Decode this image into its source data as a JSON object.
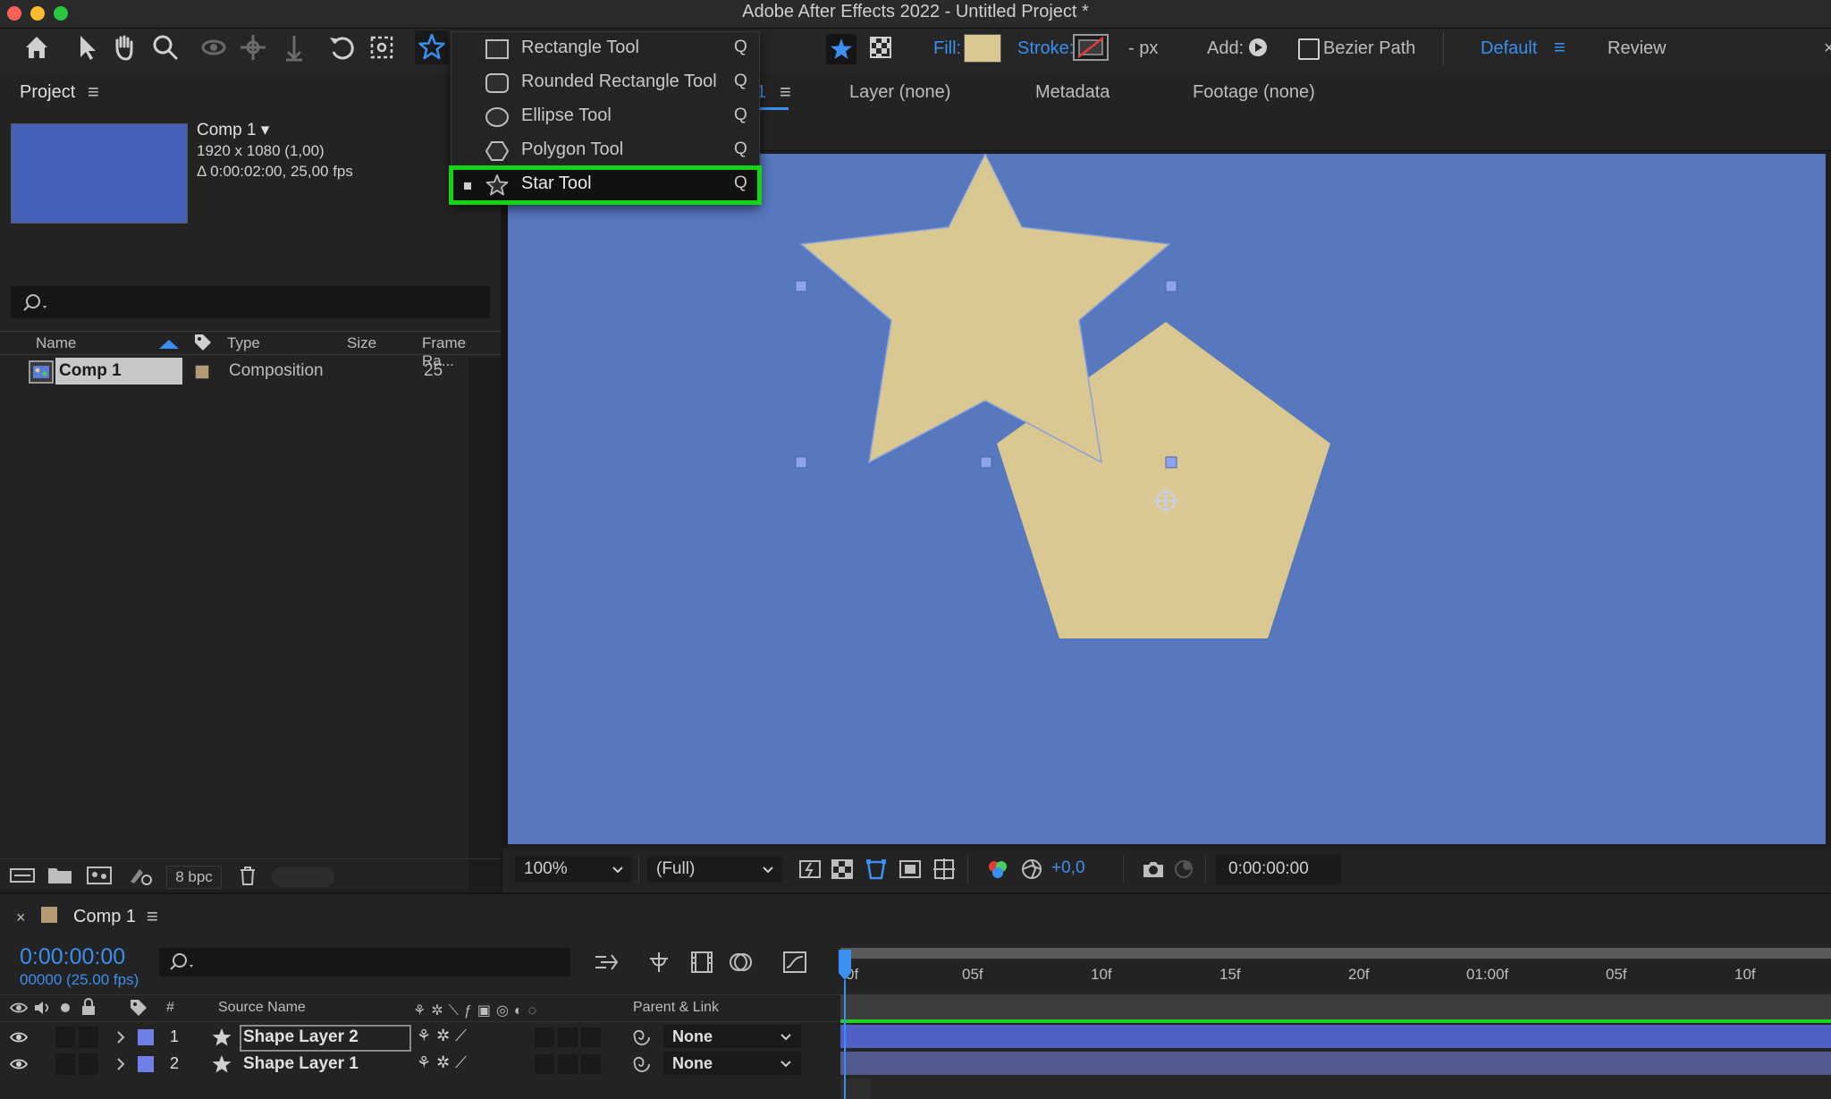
{
  "window": {
    "title": "Adobe After Effects 2022 - Untitled Project *"
  },
  "toolbar": {
    "fill_label": "Fill:",
    "stroke_label": "Stroke:",
    "stroke_px": "- px",
    "add_label": "Add:",
    "bezier_label": "Bezier Path",
    "workspace_default": "Default",
    "workspace_review": "Review",
    "fill_color": "#d9c891"
  },
  "tool_menu": {
    "items": [
      {
        "label": "Rectangle Tool",
        "key": "Q"
      },
      {
        "label": "Rounded Rectangle Tool",
        "key": "Q"
      },
      {
        "label": "Ellipse Tool",
        "key": "Q"
      },
      {
        "label": "Polygon Tool",
        "key": "Q"
      },
      {
        "label": "Star Tool",
        "key": "Q",
        "selected": true
      }
    ]
  },
  "project": {
    "title": "Project",
    "comp_name": "Comp 1 ▾",
    "comp_size": "1920 x 1080 (1,00)",
    "comp_duration": "Δ 0:00:02:00, 25,00 fps",
    "thumb_color": "#4461b8",
    "columns": {
      "name": "Name",
      "type": "Type",
      "size": "Size",
      "frame_rate": "Frame Ra..."
    },
    "items": [
      {
        "name": "Comp 1",
        "type": "Composition",
        "frame_rate": "25"
      }
    ],
    "bpc": "8 bpc"
  },
  "viewer": {
    "tab_suffix": "1",
    "tabs": [
      "Layer (none)",
      "Metadata",
      "Footage (none)"
    ],
    "bg_color": "#5777bf",
    "shape_color": "#d9c891",
    "zoom": "100%",
    "resolution": "(Full)",
    "exposure": "+0,0",
    "timecode": "0:00:00:00"
  },
  "timeline": {
    "comp_tab": "Comp 1",
    "timecode": "0:00:00:00",
    "frames": "00000 (25.00 fps)",
    "columns": {
      "num": "#",
      "source": "Source Name",
      "parent": "Parent & Link"
    },
    "ruler": [
      "0f",
      "05f",
      "10f",
      "15f",
      "20f",
      "01:00f",
      "05f",
      "10f"
    ],
    "layers": [
      {
        "num": "1",
        "name": "Shape Layer 2",
        "parent": "None",
        "color": "#6f7fe8"
      },
      {
        "num": "2",
        "name": "Shape Layer 1",
        "parent": "None",
        "color": "#6f7fe8"
      }
    ]
  }
}
